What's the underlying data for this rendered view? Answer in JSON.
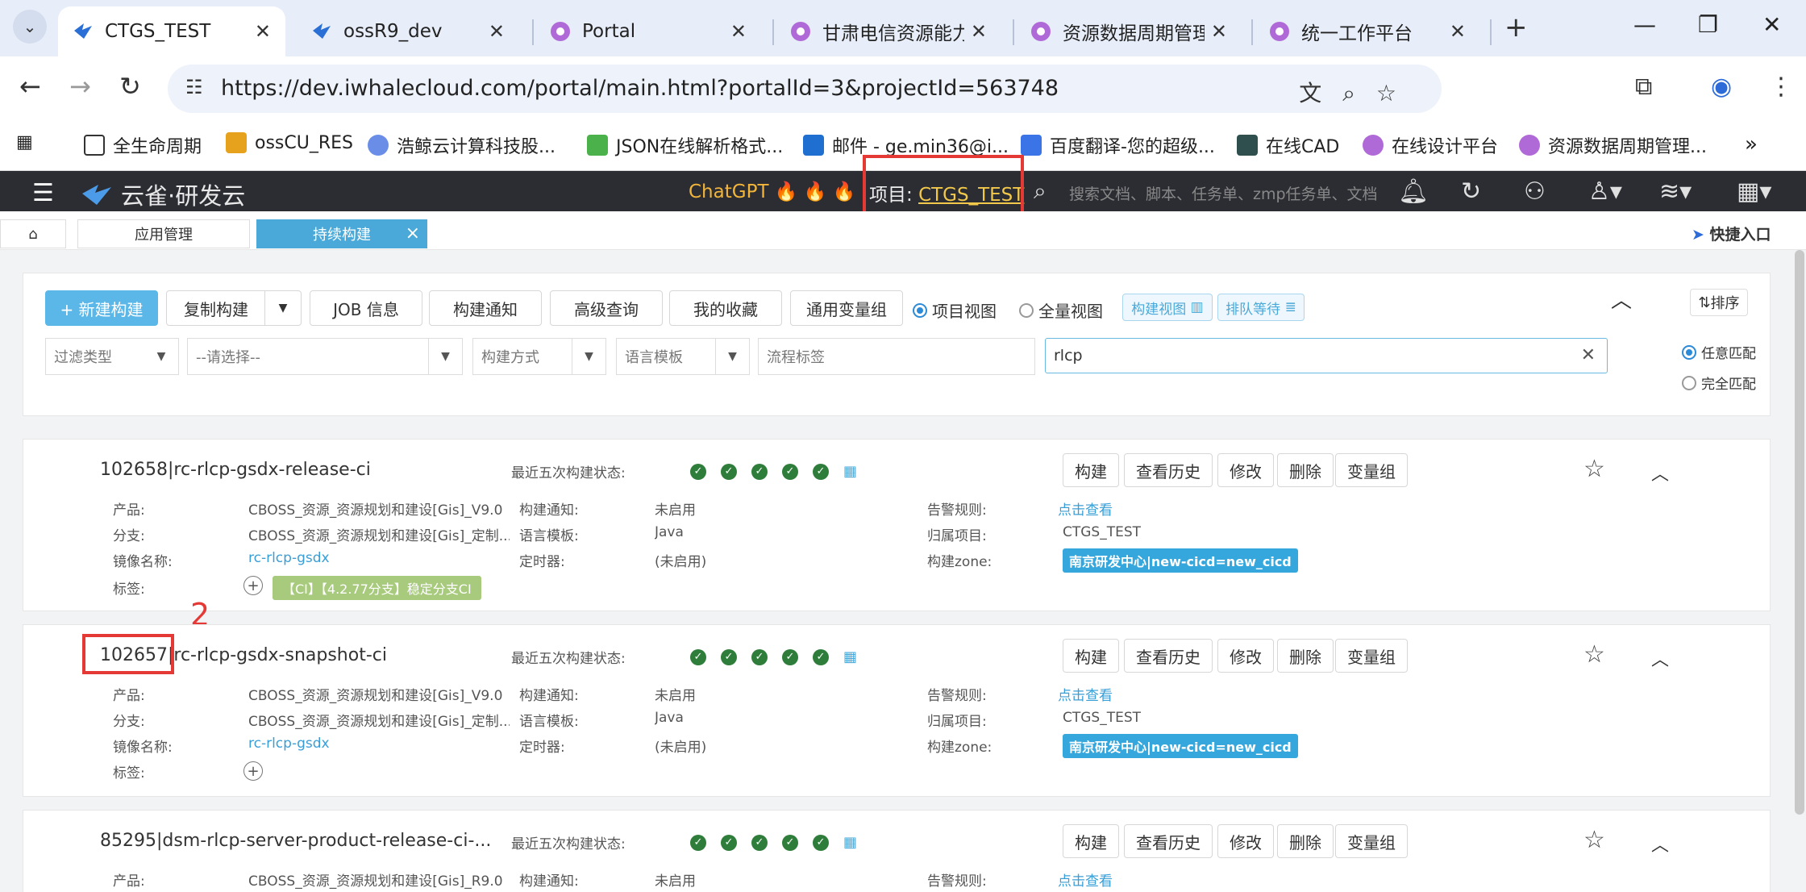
{
  "browser": {
    "tabs": [
      {
        "label": "CTGS_TEST",
        "active": true
      },
      {
        "label": "ossR9_dev"
      },
      {
        "label": "Portal"
      },
      {
        "label": "甘肃电信资源能力中"
      },
      {
        "label": "资源数据周期管理平"
      },
      {
        "label": "统一工作平台"
      }
    ],
    "url": "https://dev.iwhalecloud.com/portal/main.html?portalId=3&projectId=563748",
    "bookmarks": [
      "全生命周期",
      "ossCU_RES",
      "浩鲸云计算科技股...",
      "JSON在线解析格式...",
      "邮件 - ge.min36@i...",
      "百度翻译-您的超级...",
      "在线CAD",
      "在线设计平台",
      "资源数据周期管理..."
    ]
  },
  "app": {
    "logo": "云雀·研发云",
    "chatgpt": "ChatGPT",
    "project_prefix": "项目:",
    "project_name": "CTGS_TEST",
    "search_placeholder": "搜索文档、脚本、任务单、zmp任务单、文档"
  },
  "pagetabs": [
    "应用管理",
    "持续构建"
  ],
  "quick_entry": "快捷入口",
  "toolbar": {
    "new_build": "+ 新建构建",
    "copy_build": "复制构建",
    "buttons": [
      "JOB 信息",
      "构建通知",
      "高级查询",
      "我的收藏",
      "通用变量组"
    ],
    "view_project": "项目视图",
    "view_all": "全量视图",
    "build_view": "构建视图",
    "queue": "排队等待",
    "sort": "排序"
  },
  "filters": {
    "type": "过滤类型",
    "select": "--请选择--",
    "method": "构建方式",
    "lang": "语言模板",
    "flow_tag": "流程标签",
    "search_value": "rlcp",
    "match_any": "任意匹配",
    "match_exact": "完全匹配"
  },
  "labels": {
    "recent": "最近五次构建状态:",
    "product": "产品:",
    "branch": "分支:",
    "image": "镜像名称:",
    "tag": "标签:",
    "notify": "构建通知:",
    "lang": "语言模板:",
    "timer": "定时器:",
    "alarm": "告警规则:",
    "owner": "归属项目:",
    "zone": "构建zone:"
  },
  "actions": [
    "构建",
    "查看历史",
    "修改",
    "删除",
    "变量组"
  ],
  "jobs": [
    {
      "title": "102658|rc-rlcp-gsdx-release-ci",
      "product": "CBOSS_资源_资源规划和建设[Gis]_V9.0",
      "branch": "CBOSS_资源_资源规划和建设[Gis]_定制...",
      "image": "rc-rlcp-gsdx",
      "notify": "未启用",
      "lang": "Java",
      "timer": "(未启用)",
      "alarm": "点击查看",
      "owner": "CTGS_TEST",
      "zone": "南京研发中心|new-cicd=new_cicd",
      "tag": "【CI】【4.2.77分支】稳定分支CI"
    },
    {
      "title": "102657|rc-rlcp-gsdx-snapshot-ci",
      "product": "CBOSS_资源_资源规划和建设[Gis]_V9.0",
      "branch": "CBOSS_资源_资源规划和建设[Gis]_定制...",
      "image": "rc-rlcp-gsdx",
      "notify": "未启用",
      "lang": "Java",
      "timer": "(未启用)",
      "alarm": "点击查看",
      "owner": "CTGS_TEST",
      "zone": "南京研发中心|new-cicd=new_cicd"
    },
    {
      "title": "85295|dsm-rlcp-server-product-release-ci-...",
      "product": "CBOSS_资源_资源规划和建设[Gis]_R9.0",
      "notify": "未启用",
      "alarm": "点击查看"
    }
  ],
  "annotation_number": "2",
  "colors": {
    "accent": "#4aa9d8",
    "annotation": "#e53935",
    "success": "#2f7d3a"
  }
}
